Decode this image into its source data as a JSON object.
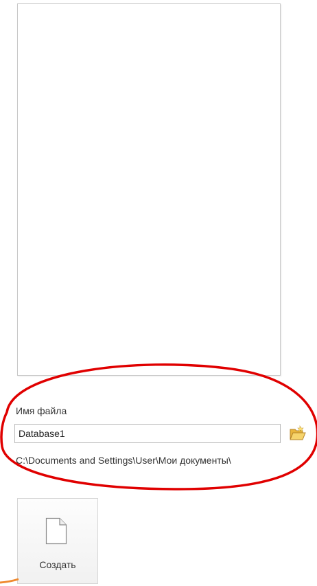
{
  "filename": {
    "label": "Имя файла",
    "value": "Database1",
    "path": "C:\\Documents and Settings\\User\\Мои документы\\"
  },
  "actions": {
    "create_label": "Создать"
  },
  "icons": {
    "browse": "folder-open-icon",
    "create": "blank-document-icon"
  },
  "colors": {
    "highlight": "#e00000",
    "arrow": "#ef8a2f",
    "folder": "#f2c24b"
  }
}
